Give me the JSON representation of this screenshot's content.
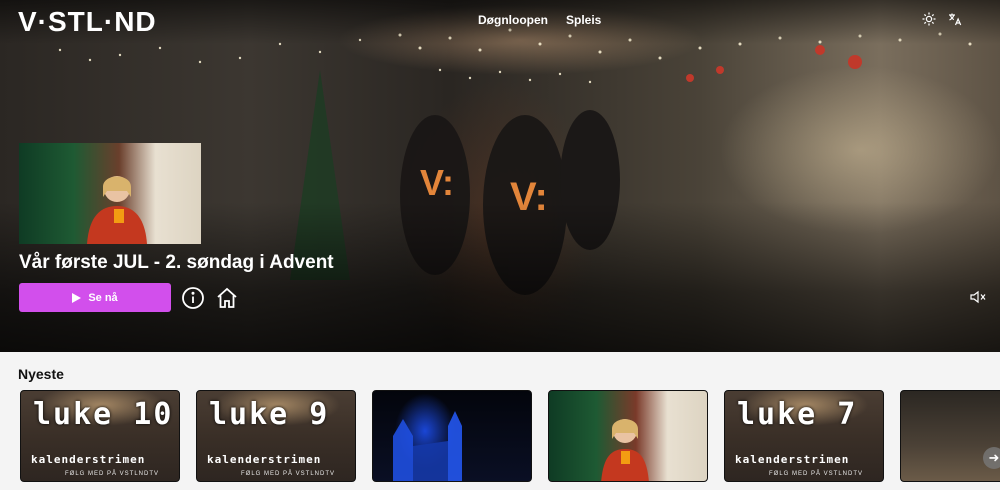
{
  "header": {
    "logo": "V·STL·ND",
    "nav": [
      {
        "label": "Døgnloopen"
      },
      {
        "label": "Spleis"
      }
    ],
    "icons": [
      "sun-icon",
      "translate-icon"
    ]
  },
  "hero": {
    "title": "Vår første JUL - 2. søndag i Advent",
    "play_label": "Se nå",
    "icons": [
      "play-icon",
      "info-icon",
      "home-icon",
      "mute-icon"
    ]
  },
  "section": {
    "title": "Nyeste",
    "cards": [
      {
        "big": "luke 10",
        "sub": "kalenderstrimen",
        "tiny": "FØLG MED PÅ VSTLNDTV"
      },
      {
        "big": "luke 9",
        "sub": "kalenderstrimen",
        "tiny": "FØLG MED PÅ VSTLNDTV"
      },
      {
        "big": "",
        "sub": "",
        "tiny": ""
      },
      {
        "big": "",
        "sub": "",
        "tiny": ""
      },
      {
        "big": "luke 7",
        "sub": "kalenderstrimen",
        "tiny": "FØLG MED PÅ VSTLNDTV"
      },
      {
        "big": "",
        "sub": "",
        "tiny": ""
      }
    ],
    "next_icon": "arrow-right-icon"
  },
  "colors": {
    "accent": "#d24fec",
    "section_bg": "#f4f4f4"
  }
}
